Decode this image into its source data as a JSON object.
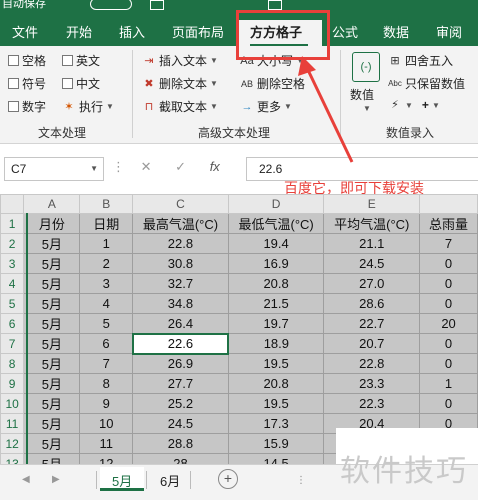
{
  "quick_access": {
    "autosave_label": "自动保存",
    "toggle_label": "关"
  },
  "tabs": [
    {
      "label": "文件"
    },
    {
      "label": "开始"
    },
    {
      "label": "插入"
    },
    {
      "label": "页面布局"
    },
    {
      "label": "方方格子",
      "active": true
    },
    {
      "label": "公式"
    },
    {
      "label": "数据"
    },
    {
      "label": "审阅"
    }
  ],
  "ribbon": {
    "text_processing": {
      "group_label": "文本处理",
      "checkboxes": [
        {
          "label": "空格"
        },
        {
          "label": "英文"
        },
        {
          "label": "符号"
        },
        {
          "label": "中文"
        },
        {
          "label": "数字"
        }
      ],
      "execute_label": "执行"
    },
    "advanced_text": {
      "group_label": "高级文本处理",
      "items": [
        {
          "label": "插入文本",
          "icon": "insert-text-icon"
        },
        {
          "label": "删除文本",
          "icon": "delete-text-icon"
        },
        {
          "label": "截取文本",
          "icon": "extract-text-icon"
        },
        {
          "label": "大小写",
          "icon": "case-icon"
        },
        {
          "label": "删除空格",
          "icon": "delete-space-icon"
        },
        {
          "label": "更多",
          "icon": "arrow-right-icon"
        }
      ]
    },
    "number_entry": {
      "group_label": "数值录入",
      "big_button_label": "数值",
      "items": [
        {
          "label": "四舍五入"
        },
        {
          "label": "只保留数值"
        },
        {
          "label": "+"
        }
      ]
    }
  },
  "formula_bar": {
    "cell_ref": "C7",
    "cancel_symbol": "✕",
    "confirm_symbol": "✓",
    "fx_symbol": "fx",
    "value": "22.6"
  },
  "annotation": "百度它，即可下载安装",
  "sheet": {
    "columns": [
      "A",
      "B",
      "C",
      "D",
      "E",
      ""
    ],
    "headers": [
      "月份",
      "日期",
      "最高气温(°C)",
      "最低气温(°C)",
      "平均气温(°C)",
      "总雨量"
    ],
    "rows": [
      {
        "row": "2",
        "cells": [
          "5月",
          "1",
          "22.8",
          "19.4",
          "21.1",
          "7"
        ]
      },
      {
        "row": "3",
        "cells": [
          "5月",
          "2",
          "30.8",
          "16.9",
          "24.5",
          "0"
        ]
      },
      {
        "row": "4",
        "cells": [
          "5月",
          "3",
          "32.7",
          "20.8",
          "27.0",
          "0"
        ]
      },
      {
        "row": "5",
        "cells": [
          "5月",
          "4",
          "34.8",
          "21.5",
          "28.6",
          "0"
        ]
      },
      {
        "row": "6",
        "cells": [
          "5月",
          "5",
          "26.4",
          "19.7",
          "22.7",
          "20"
        ]
      },
      {
        "row": "7",
        "cells": [
          "5月",
          "6",
          "22.6",
          "18.9",
          "20.7",
          "0"
        ]
      },
      {
        "row": "8",
        "cells": [
          "5月",
          "7",
          "26.9",
          "19.5",
          "22.8",
          "0"
        ]
      },
      {
        "row": "9",
        "cells": [
          "5月",
          "8",
          "27.7",
          "20.8",
          "23.3",
          "1"
        ]
      },
      {
        "row": "10",
        "cells": [
          "5月",
          "9",
          "25.2",
          "19.5",
          "22.3",
          "0"
        ]
      },
      {
        "row": "11",
        "cells": [
          "5月",
          "10",
          "24.5",
          "17.3",
          "20.4",
          "0"
        ]
      },
      {
        "row": "12",
        "cells": [
          "5月",
          "11",
          "28.8",
          "15.9",
          "",
          ""
        ]
      },
      {
        "row": "13",
        "cells": [
          "5月",
          "12",
          "28",
          "14.5",
          "",
          ""
        ]
      },
      {
        "row": "14",
        "cells": [
          "",
          "",
          "",
          "",
          "",
          ""
        ]
      }
    ],
    "active_cell": "C7"
  },
  "sheet_tabs": [
    {
      "label": "5月",
      "active": true
    },
    {
      "label": "6月"
    }
  ],
  "watermark": "软件技巧"
}
